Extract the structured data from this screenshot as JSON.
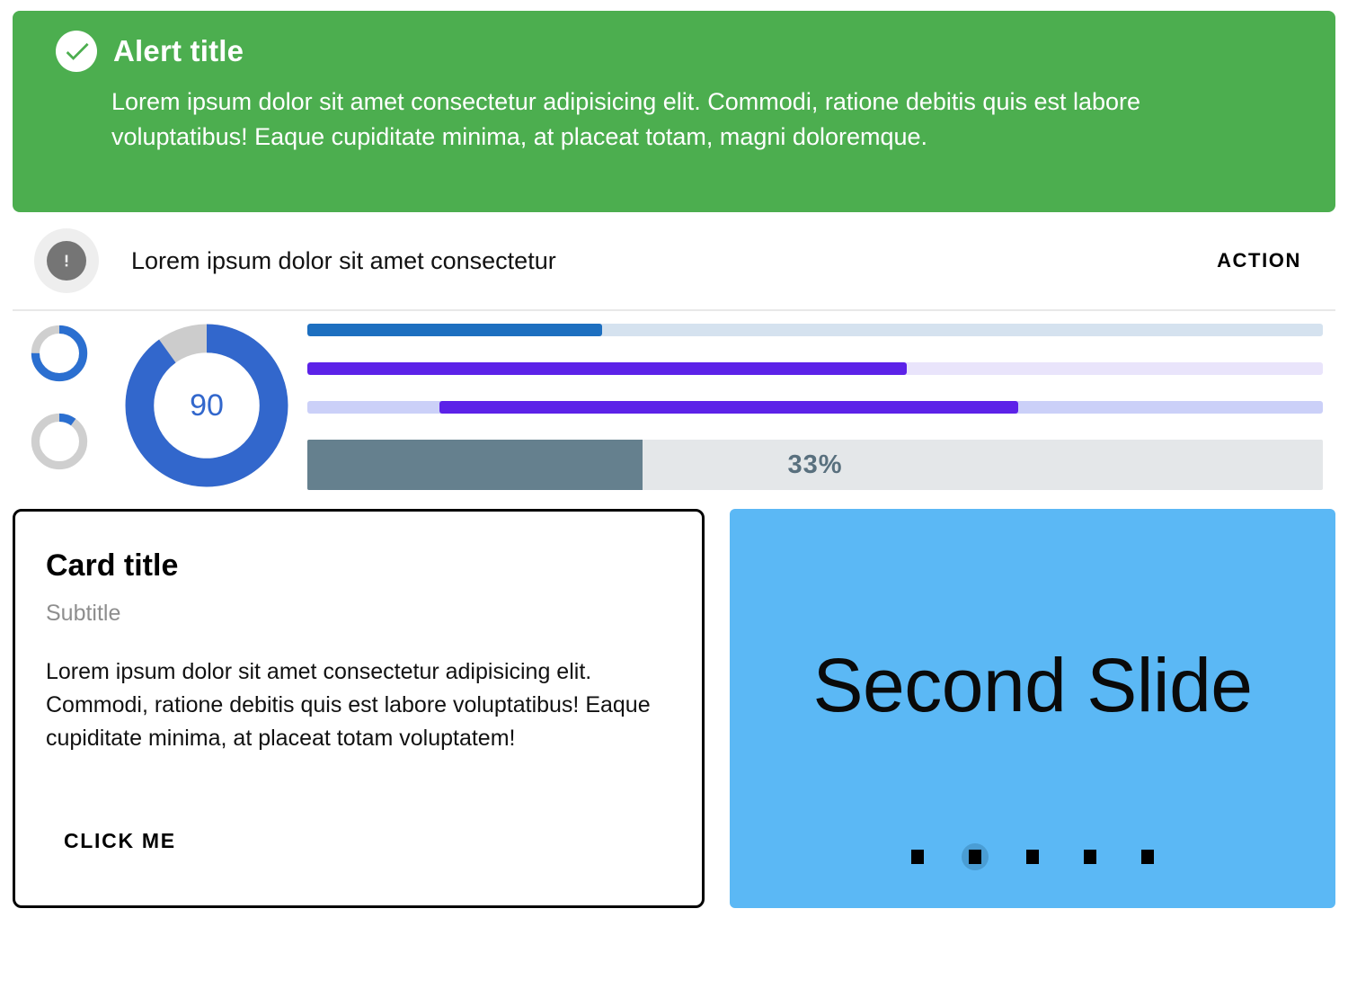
{
  "theme": {
    "alert_green": "#4cae4f",
    "carousel_blue": "#5bb8f5",
    "donut_blue": "#3267cc",
    "bar_blue": "#1d6fc0",
    "bar_purple": "#5c22e8",
    "bar_slate": "#65808e",
    "track_grey": "#e4e7e9"
  },
  "alert": {
    "icon": "check-circle-icon",
    "title": "Alert title",
    "body": "Lorem ipsum dolor sit amet consectetur adipisicing elit. Commodi, ratione debitis quis est labore voluptatibus! Eaque cupiditate minima, at placeat totam, magni doloremque."
  },
  "snackbar": {
    "icon": "exclamation-circle-icon",
    "message": "Lorem ipsum dolor sit amet consectetur",
    "action_label": "ACTION"
  },
  "spinners": [
    {
      "name": "spinner-top",
      "value": 75,
      "track": "#cfcfcf",
      "color": "#2b6fd0"
    },
    {
      "name": "spinner-bottom",
      "value": 10,
      "track": "#cfcfcf",
      "color": "#2b6fd0"
    }
  ],
  "donut": {
    "value": 90,
    "label": "90",
    "max": 100,
    "color": "#3267cc",
    "track": "#cccccc"
  },
  "bars": [
    {
      "name": "progress-bar-blue",
      "value": 29,
      "buffer_start": 0,
      "color": "#1d6fc0",
      "track": "#d5e2ef"
    },
    {
      "name": "progress-bar-purple",
      "value": 59,
      "buffer_start": 0,
      "color": "#5c22e8",
      "track": "#e9e4fb"
    },
    {
      "name": "progress-bar-purple-range",
      "value": 57,
      "buffer_start": 13,
      "color": "#5c22e8",
      "track": "#cbd0f8"
    }
  ],
  "big_bar": {
    "name": "progress-bar-labeled",
    "value": 33,
    "label": "33%",
    "color": "#65808e",
    "track": "#e4e7e9"
  },
  "card": {
    "title": "Card title",
    "subtitle": "Subtitle",
    "text": "Lorem ipsum dolor sit amet consectetur adipisicing elit. Commodi, ratione debitis quis est labore voluptatibus! Eaque cupiditate minima, at placeat totam voluptatem!",
    "button_label": "CLICK ME"
  },
  "carousel": {
    "caption": "Second Slide",
    "active_index": 1,
    "dot_count": 5
  }
}
